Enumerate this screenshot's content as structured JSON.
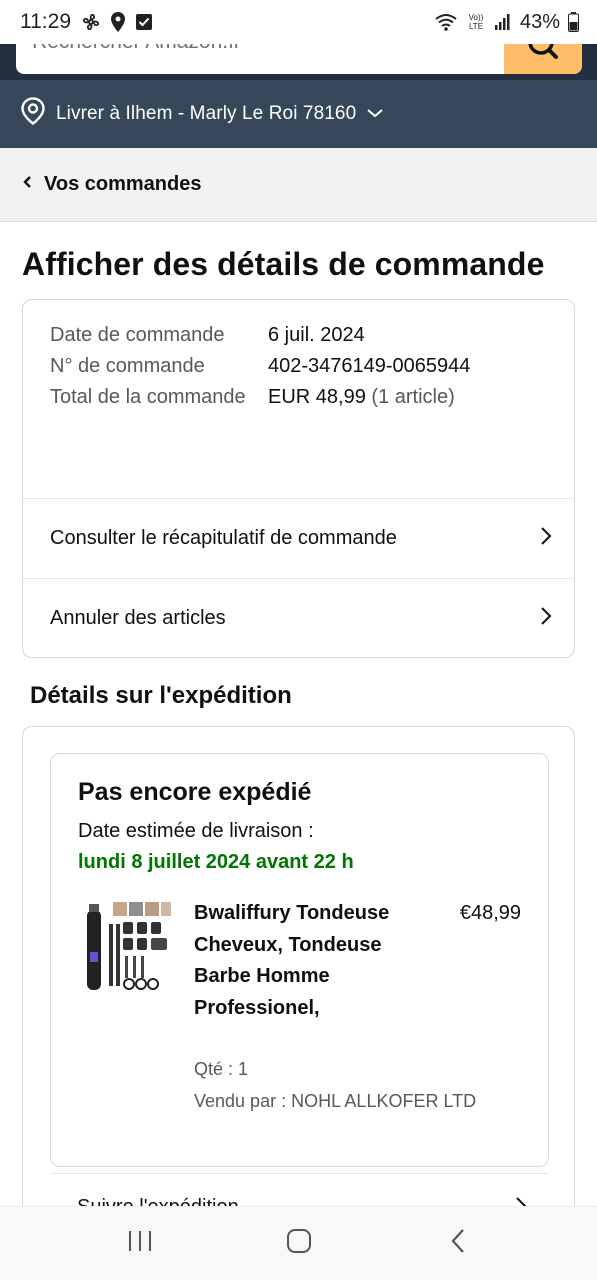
{
  "status_bar": {
    "time": "11:29",
    "battery": "43%",
    "icons": [
      "fan-icon",
      "location-pin-icon",
      "checkbox-icon",
      "wifi-icon",
      "volte-icon",
      "signal-icon",
      "battery-icon"
    ],
    "volte_label": "Vo)\nLTE"
  },
  "search": {
    "placeholder": "Rechercher Amazon.fr",
    "icon": "search-icon"
  },
  "delivery": {
    "label": "Livrer à Ilhem - Marly Le Roi 78160"
  },
  "back_nav": {
    "label": "Vos commandes"
  },
  "page": {
    "title": "Afficher des détails de commande"
  },
  "order_summary": {
    "rows": [
      {
        "label": "Date de commande",
        "value": "6 juil. 2024"
      },
      {
        "label": "N° de commande",
        "value": "402-3476149-0065944"
      },
      {
        "label": "Total de la commande",
        "value": "EUR 48,99",
        "value_extra": "(1 article)"
      }
    ],
    "links": [
      {
        "label": "Consulter le récapitulatif de commande"
      },
      {
        "label": "Annuler des articles"
      }
    ]
  },
  "shipment": {
    "section_title": "Détails sur l'expédition",
    "status": "Pas encore expédié",
    "estimate_label": "Date estimée de livraison :",
    "estimate_date": "lundi 8 juillet 2024 avant 22 h",
    "product": {
      "title": "Bwaliffury Tondeuse Cheveux, Tondeuse Barbe Homme Professionel,",
      "price": "€48,99",
      "qty": "Qté : 1",
      "seller": "Vendu par : NOHL ALLKOFER LTD"
    },
    "track_label": "Suivre l'expédition"
  },
  "colors": {
    "header": "#232f3e",
    "delivery_bar": "#37475a",
    "search_button": "#febd69",
    "delivery_green": "#007600"
  }
}
